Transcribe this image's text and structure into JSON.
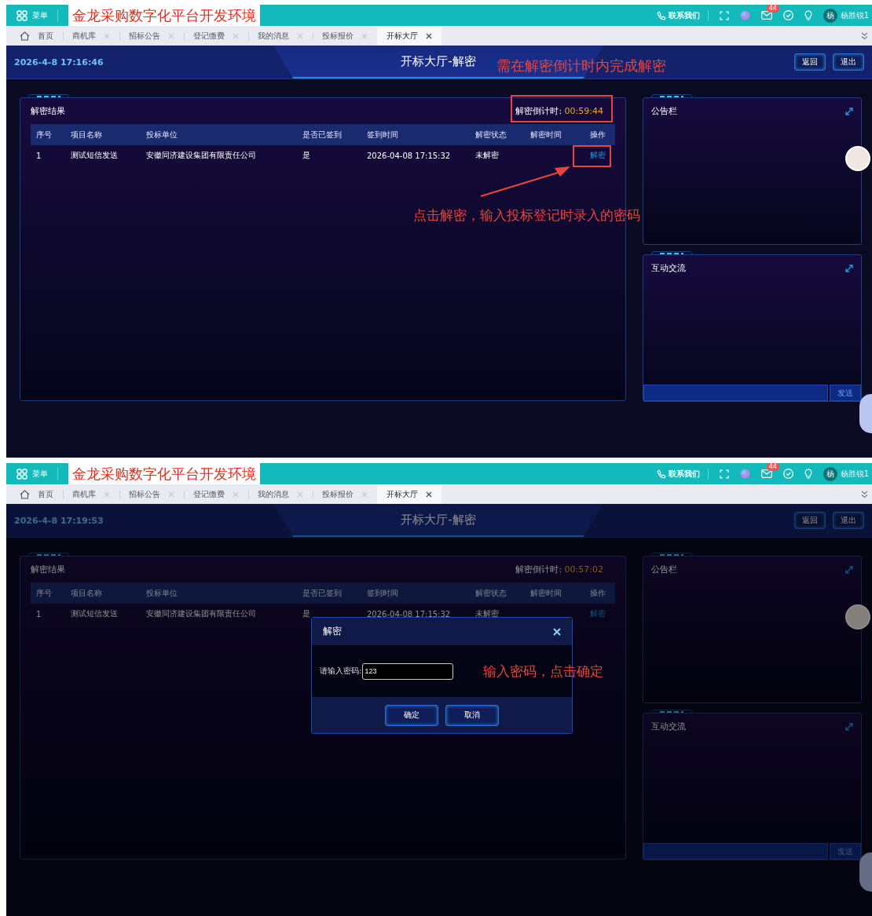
{
  "screens": [
    {
      "menu_label": "菜单",
      "env_title": "金龙采购数字化平台开发环境",
      "contact": "联系我们",
      "mail_badge": "44",
      "user_initial": "杨",
      "user_name": "杨胜锐1",
      "tabs": [
        {
          "label": "首页",
          "kind": "home",
          "selected": false
        },
        {
          "label": "商机库",
          "kind": "closable",
          "selected": false
        },
        {
          "label": "招标公告",
          "kind": "closable",
          "selected": false
        },
        {
          "label": "登记缴费",
          "kind": "closable",
          "selected": false
        },
        {
          "label": "我的消息",
          "kind": "closable",
          "selected": false
        },
        {
          "label": "投标报价",
          "kind": "closable",
          "selected": false
        },
        {
          "label": "开标大厅",
          "kind": "closable",
          "selected": true
        }
      ],
      "datetime": "2026-4-8 17:16:46",
      "page_title": "开标大厅-解密",
      "header_buttons": [
        "返回",
        "退出"
      ],
      "results": {
        "title": "解密结果",
        "countdown_label": "解密倒计时:",
        "countdown": "00:59:44",
        "columns": [
          "序号",
          "项目名称",
          "投标单位",
          "是否已签到",
          "签到时间",
          "解密状态",
          "解密时间",
          "操作"
        ],
        "rows": [
          {
            "cells": [
              "1",
              "测试短信发送",
              "安徽同济建设集团有限责任公司",
              "是",
              "2026-04-08 17:15:32",
              "未解密",
              ""
            ],
            "action": "解密"
          }
        ]
      },
      "notice_title": "公告栏",
      "chat_title": "互动交流",
      "send_label": "发送",
      "dimmed": false,
      "annotations": [
        {
          "kind": "title-note",
          "text": "需在解密倒计时内完成解密"
        },
        {
          "kind": "countdown-box"
        },
        {
          "kind": "action-box"
        },
        {
          "kind": "action-arrow"
        },
        {
          "kind": "action-note",
          "text": "点击解密，输入投标登记时录入的密码"
        }
      ]
    },
    {
      "menu_label": "菜单",
      "env_title": "金龙采购数字化平台开发环境",
      "contact": "联系我们",
      "mail_badge": "44",
      "user_initial": "杨",
      "user_name": "杨胜锐1",
      "tabs": [
        {
          "label": "首页",
          "kind": "home",
          "selected": false
        },
        {
          "label": "商机库",
          "kind": "closable",
          "selected": false
        },
        {
          "label": "招标公告",
          "kind": "closable",
          "selected": false
        },
        {
          "label": "登记缴费",
          "kind": "closable",
          "selected": false
        },
        {
          "label": "我的消息",
          "kind": "closable",
          "selected": false
        },
        {
          "label": "投标报价",
          "kind": "closable",
          "selected": false
        },
        {
          "label": "开标大厅",
          "kind": "closable",
          "selected": true
        }
      ],
      "datetime": "2026-4-8 17:19:53",
      "page_title": "开标大厅-解密",
      "header_buttons": [
        "返回",
        "退出"
      ],
      "results": {
        "title": "解密结果",
        "countdown_label": "解密倒计时:",
        "countdown": "00:57:02",
        "columns": [
          "序号",
          "项目名称",
          "投标单位",
          "是否已签到",
          "签到时间",
          "解密状态",
          "解密时间",
          "操作"
        ],
        "rows": [
          {
            "cells": [
              "1",
              "测试短信发送",
              "安徽同济建设集团有限责任公司",
              "是",
              "2026-04-08 17:15:32",
              "未解密",
              ""
            ],
            "action": "解密"
          }
        ]
      },
      "notice_title": "公告栏",
      "chat_title": "互动交流",
      "send_label": "发送",
      "dimmed": true,
      "dialog": {
        "title": "解密",
        "field_label": "请输入密码:",
        "field_value": "123",
        "buttons": [
          "确定",
          "取消"
        ]
      },
      "annotations": [
        {
          "kind": "dialog-note",
          "text": "输入密码，点击确定"
        }
      ]
    }
  ]
}
